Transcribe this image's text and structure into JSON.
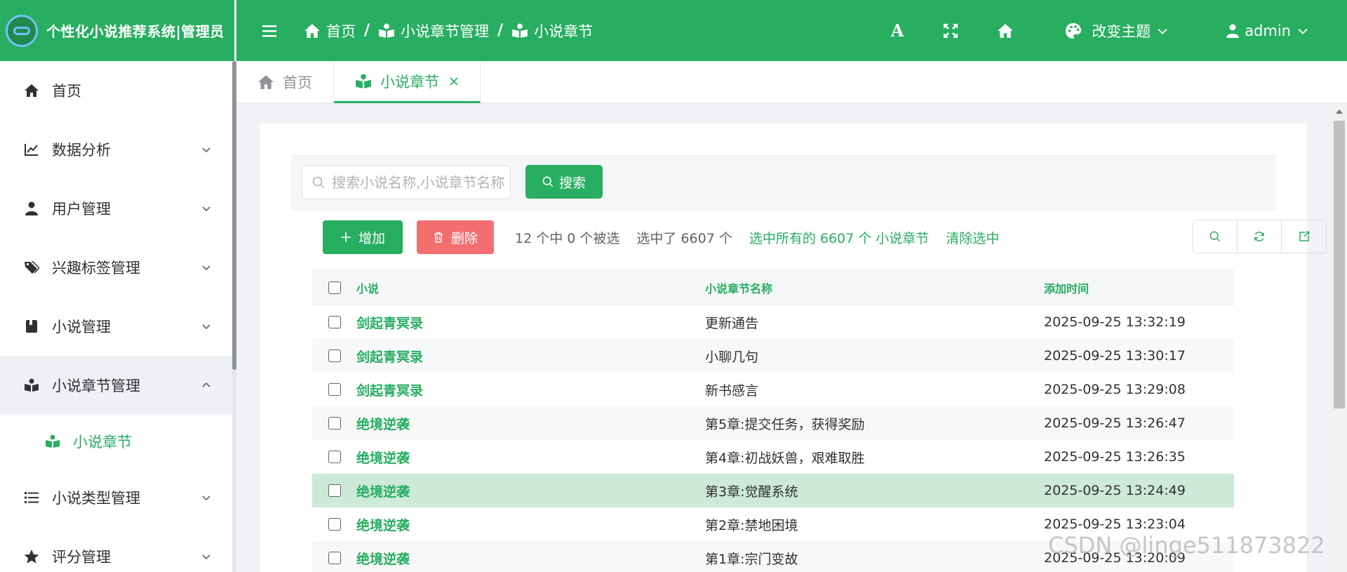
{
  "brand": {
    "title": "个性化小说推荐系统|管理员"
  },
  "colors": {
    "primary": "#27ae60",
    "danger": "#f36f6f",
    "highlight_row": "#cde9d8"
  },
  "sidebar": {
    "items": [
      {
        "label": "首页",
        "icon": "home-icon",
        "expandable": false
      },
      {
        "label": "数据分析",
        "icon": "chart-line-icon",
        "expandable": true
      },
      {
        "label": "用户管理",
        "icon": "user-icon",
        "expandable": true
      },
      {
        "label": "兴趣标签管理",
        "icon": "tags-icon",
        "expandable": true
      },
      {
        "label": "小说管理",
        "icon": "book-icon",
        "expandable": true
      },
      {
        "label": "小说章节管理",
        "icon": "reader-icon",
        "expandable": true,
        "open": true
      },
      {
        "label": "小说类型管理",
        "icon": "list-icon",
        "expandable": true
      },
      {
        "label": "评分管理",
        "icon": "star-icon",
        "expandable": true
      }
    ],
    "sub_item": {
      "label": "小说章节",
      "icon": "reader-icon"
    }
  },
  "header": {
    "breadcrumb": [
      "首页",
      "小说章节管理",
      "小说章节"
    ],
    "theme_label": "改变主题",
    "user_label": "admin",
    "font_icon_letter": "A"
  },
  "tabs": [
    {
      "label": "首页",
      "active": false
    },
    {
      "label": "小说章节",
      "active": true
    }
  ],
  "search": {
    "placeholder": "搜索小说名称,小说章节名称",
    "value": "",
    "button_label": "搜索"
  },
  "actions": {
    "add_label": "增加",
    "delete_label": "删除",
    "selection_info": "12 个中 0 个被选",
    "selected_all_info": "选中了 6607 个",
    "select_all_link": "选中所有的 6607 个 小说章节",
    "clear_link": "清除选中"
  },
  "table": {
    "columns": [
      "小说",
      "小说章节名称",
      "添加时间"
    ],
    "rows": [
      {
        "novel": "剑起青冥录",
        "chapter": "更新通告",
        "time": "2025-09-25 13:32:19"
      },
      {
        "novel": "剑起青冥录",
        "chapter": "小聊几句",
        "time": "2025-09-25 13:30:17"
      },
      {
        "novel": "剑起青冥录",
        "chapter": "新书感言",
        "time": "2025-09-25 13:29:08"
      },
      {
        "novel": "绝境逆袭",
        "chapter": "第5章:提交任务，获得奖励",
        "time": "2025-09-25 13:26:47"
      },
      {
        "novel": "绝境逆袭",
        "chapter": "第4章:初战妖兽，艰难取胜",
        "time": "2025-09-25 13:26:35"
      },
      {
        "novel": "绝境逆袭",
        "chapter": "第3章:觉醒系统",
        "time": "2025-09-25 13:24:49"
      },
      {
        "novel": "绝境逆袭",
        "chapter": "第2章:禁地困境",
        "time": "2025-09-25 13:23:04"
      },
      {
        "novel": "绝境逆袭",
        "chapter": "第1章:宗门变故",
        "time": "2025-09-25 13:20:09"
      }
    ]
  },
  "watermark": "CSDN @linge511873822"
}
